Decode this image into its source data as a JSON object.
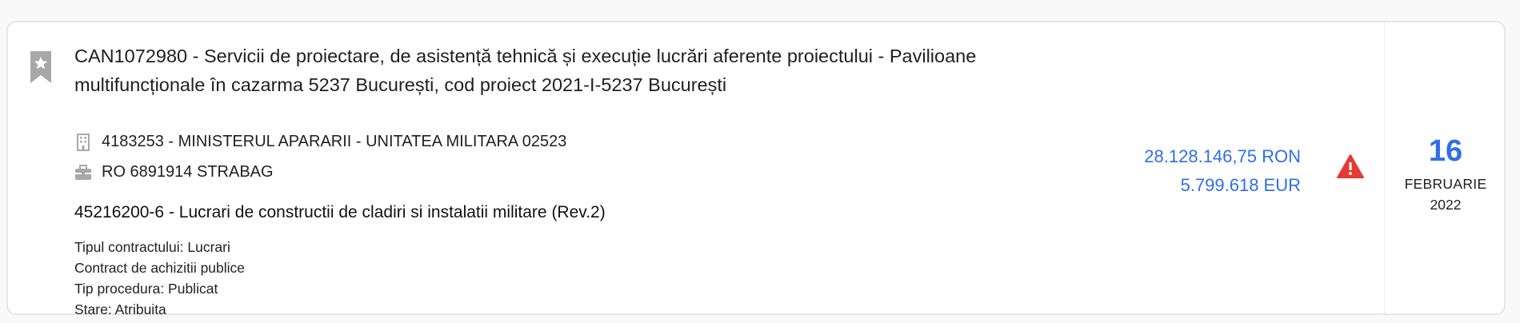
{
  "notice": {
    "title": "CAN1072980 - Servicii de proiectare, de asistență tehnică și execuție lucrări aferente proiectului - Pavilioane multifuncționale în cazarma 5237 București, cod proiect 2021-I-5237 București",
    "authority": "4183253 - MINISTERUL APARARII - UNITATEA MILITARA 02523",
    "supplier": "RO 6891914 STRABAG",
    "cpv": "45216200-6 - Lucrari de constructii de cladiri si instalatii militare (Rev.2)",
    "meta": {
      "contract_type": "Tipul contractului: Lucrari",
      "contract_kind": "Contract de achizitii publice",
      "procedure": "Tip procedura: Publicat",
      "status": "Stare: Atribuita"
    },
    "amount_ron": "28.128.146,75 RON",
    "amount_eur": "5.799.618 EUR",
    "date": {
      "day": "16",
      "month": "FEBRUARIE",
      "year": "2022"
    }
  },
  "icons": {
    "bookmark": "bookmark-star-icon",
    "authority": "building-icon",
    "supplier": "briefcase-icon",
    "warning": "warning-triangle-icon"
  },
  "colors": {
    "accent": "#2f6fe8",
    "warning": "#e53935",
    "icon_gray": "#a8a8a8"
  }
}
